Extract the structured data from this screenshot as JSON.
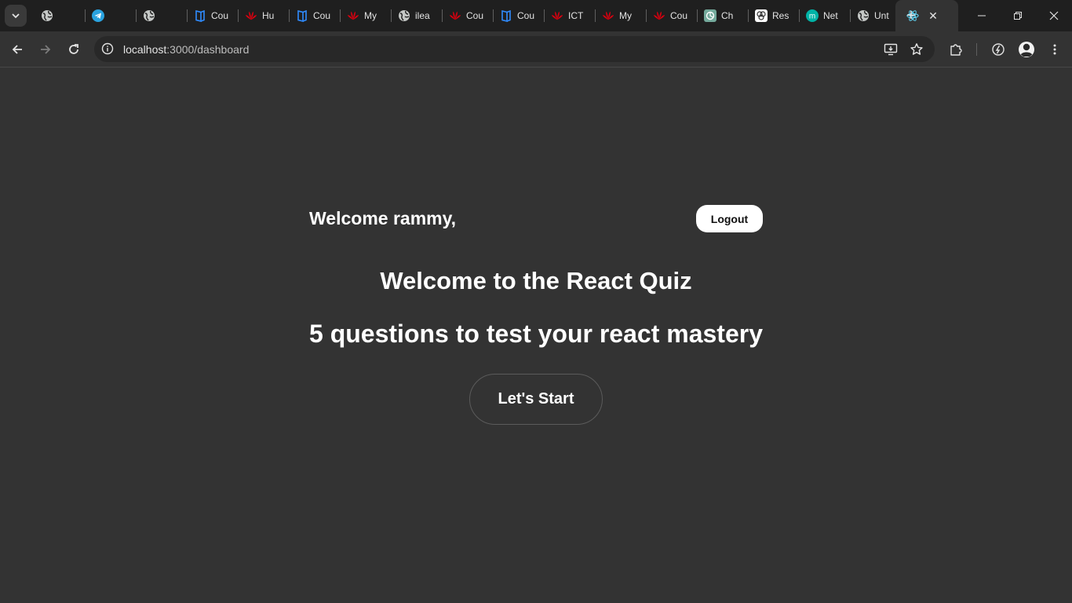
{
  "browser": {
    "tabs": [
      {
        "title": "",
        "icon": "globe-icon",
        "color": "#c4c7c5"
      },
      {
        "title": "",
        "icon": "telegram-icon",
        "color": "#2aa3e0"
      },
      {
        "title": "",
        "icon": "globe-icon",
        "color": "#c4c7c5"
      },
      {
        "title": "Cou",
        "icon": "book-icon",
        "color": "#2f8cff"
      },
      {
        "title": "Hu",
        "icon": "huawei-icon",
        "color": "#d7000f"
      },
      {
        "title": "Cou",
        "icon": "book-icon",
        "color": "#2f8cff"
      },
      {
        "title": "My",
        "icon": "huawei-icon",
        "color": "#d7000f"
      },
      {
        "title": "ilea",
        "icon": "globe-icon",
        "color": "#c4c7c5"
      },
      {
        "title": "Cou",
        "icon": "huawei-icon",
        "color": "#d7000f"
      },
      {
        "title": "Cou",
        "icon": "book-icon",
        "color": "#2f8cff"
      },
      {
        "title": "ICT",
        "icon": "huawei-icon",
        "color": "#d7000f"
      },
      {
        "title": "My",
        "icon": "huawei-icon",
        "color": "#d7000f"
      },
      {
        "title": "Cou",
        "icon": "huawei-icon",
        "color": "#d7000f"
      },
      {
        "title": "Ch",
        "icon": "chatgpt-icon",
        "color": "#74aa9c"
      },
      {
        "title": "Res",
        "icon": "render-icon",
        "color": "#ffffff"
      },
      {
        "title": "Net",
        "icon": "m-circle-icon",
        "color": "#00b3a6"
      },
      {
        "title": "Unt",
        "icon": "globe-icon",
        "color": "#c4c7c5"
      },
      {
        "title": "",
        "icon": "react-icon",
        "color": "#61dafb",
        "active": true
      }
    ],
    "close_glyph": "✕",
    "new_tab_glyph": "+",
    "url_host": "localhost",
    "url_rest": ":3000/dashboard"
  },
  "page": {
    "greeting": "Welcome rammy,",
    "logout_label": "Logout",
    "title": "Welcome to the React Quiz",
    "subtitle": "5 questions to test your react mastery",
    "start_label": "Let's Start"
  },
  "colors": {
    "tabstrip_bg": "#1f1f1f",
    "page_bg": "#333333",
    "text": "#ffffff"
  }
}
